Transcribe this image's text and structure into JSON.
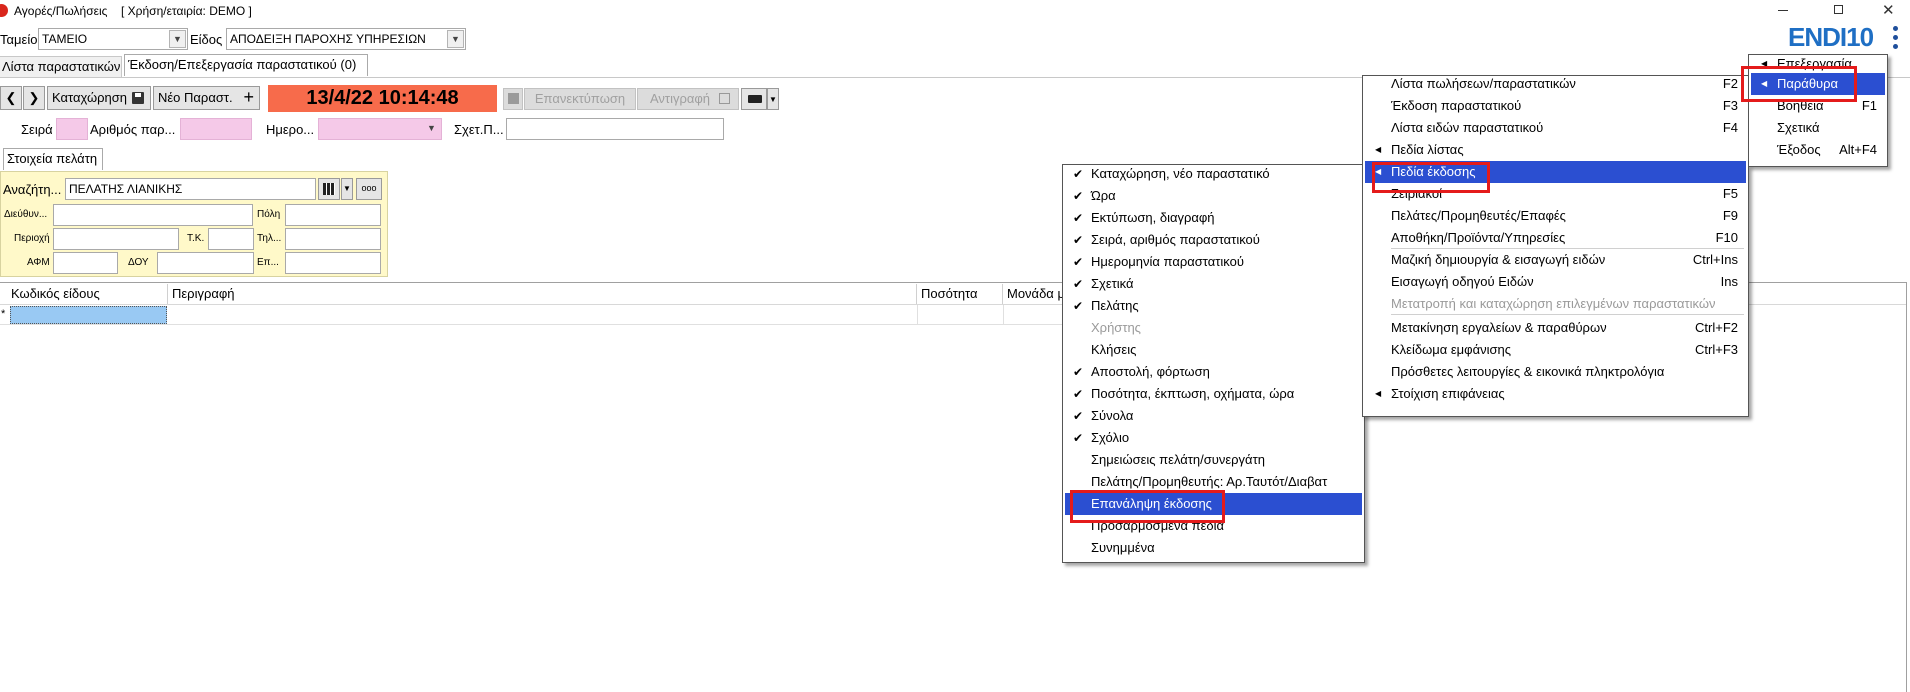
{
  "window": {
    "title": "Αγορές/Πωλήσεις",
    "context": "[ Χρήση/εταιρία: DEMO ]",
    "brand": "ENDI10"
  },
  "filters": {
    "tameio_label": "Ταμείο",
    "tameio_value": "ΤΑΜΕΙΟ",
    "eidos_label": "Είδος",
    "eidos_value": "ΑΠΟΔΕΙΞΗ ΠΑΡΟΧΗΣ ΥΠΗΡΕΣΙΩΝ"
  },
  "tabs": [
    {
      "label": "Λίστα παραστατικών"
    },
    {
      "label": "Έκδοση/Επεξεργασία παραστατικού (0)"
    }
  ],
  "toolbar": {
    "save_label": "Καταχώρηση",
    "new_label": "Νέο Παραστ.",
    "datetime": "13/4/22 10:14:48",
    "reprint_label": "Επανεκτύπωση",
    "copy_label": "Αντιγραφή"
  },
  "fields": {
    "series_label": "Σειρά",
    "number_label": "Αριθμός παρ...",
    "date_label": "Ημερο...",
    "related_label": "Σχετ.Π..."
  },
  "customer": {
    "tab_label": "Στοιχεία πελάτη",
    "search_label": "Αναζήτη...",
    "search_value": "ΠΕΛΑΤΗΣ ΛΙΑΝΙΚΗΣ",
    "address_label": "Διεύθυν...",
    "city_label": "Πόλη",
    "area_label": "Περιοχή",
    "zip_label": "Τ.Κ.",
    "phone_label": "Τηλ...",
    "afm_label": "ΑΦΜ",
    "doy_label": "ΔΟΥ",
    "job_label": "Επ..."
  },
  "grid": {
    "columns": [
      "Κωδικός είδους",
      "Περιγραφή",
      "Ποσότητα",
      "Μονάδα μ"
    ],
    "new_row_marker": "*"
  },
  "top_menu": {
    "items": [
      {
        "label": "Επεξεργασία",
        "shortcut": ""
      },
      {
        "label": "Παράθυρα",
        "shortcut": ""
      },
      {
        "label": "Βοήθεια",
        "shortcut": "F1"
      },
      {
        "label": "Σχετικά",
        "shortcut": ""
      },
      {
        "label": "Έξοδος",
        "shortcut": "Alt+F4"
      }
    ]
  },
  "windows_menu": {
    "items": [
      {
        "label": "Λίστα πωλήσεων/παραστατικών",
        "shortcut": "F2"
      },
      {
        "label": "Έκδοση παραστατικού",
        "shortcut": "F3"
      },
      {
        "label": "Λίστα ειδών παραστατικού",
        "shortcut": "F4"
      },
      {
        "label": "Πεδία λίστας",
        "shortcut": ""
      },
      {
        "label": "Πεδία έκδοσης",
        "shortcut": ""
      },
      {
        "label": "Σειριακοί",
        "shortcut": "F5"
      },
      {
        "label": "Πελάτες/Προμηθευτές/Επαφές",
        "shortcut": "F9"
      },
      {
        "label": "Αποθήκη/Προϊόντα/Υπηρεσίες",
        "shortcut": "F10"
      },
      {
        "label": "Μαζική δημιουργία & εισαγωγή ειδών",
        "shortcut": "Ctrl+Ins"
      },
      {
        "label": "Εισαγωγή οδηγού Ειδών",
        "shortcut": "Ins"
      },
      {
        "label": "Μετατροπή και καταχώρηση επιλεγμένων παραστατικών",
        "shortcut": ""
      },
      {
        "label": "Μετακίνηση εργαλείων & παραθύρων",
        "shortcut": "Ctrl+F2"
      },
      {
        "label": "Κλείδωμα εμφάνισης",
        "shortcut": "Ctrl+F3"
      },
      {
        "label": "Πρόσθετες λειτουργίες & εικονικά πληκτρολόγια",
        "shortcut": ""
      },
      {
        "label": "Στοίχιση επιφάνειας",
        "shortcut": ""
      }
    ]
  },
  "fields_menu": {
    "items": [
      {
        "label": "Καταχώρηση, νέο παραστατικό",
        "checked": true
      },
      {
        "label": "Ώρα",
        "checked": true
      },
      {
        "label": "Εκτύπωση, διαγραφή",
        "checked": true
      },
      {
        "label": "Σειρά, αριθμός παραστατικού",
        "checked": true
      },
      {
        "label": "Ημερομηνία παραστατικού",
        "checked": true
      },
      {
        "label": "Σχετικά",
        "checked": true
      },
      {
        "label": "Πελάτης",
        "checked": true
      },
      {
        "label": "Χρήστης",
        "checked": false
      },
      {
        "label": "Κλήσεις",
        "checked": false
      },
      {
        "label": "Αποστολή, φόρτωση",
        "checked": true
      },
      {
        "label": "Ποσότητα, έκπτωση, οχήματα, ώρα",
        "checked": true
      },
      {
        "label": "Σύνολα",
        "checked": true
      },
      {
        "label": "Σχόλιο",
        "checked": true
      },
      {
        "label": "Σημειώσεις πελάτη/συνεργάτη",
        "checked": false
      },
      {
        "label": "Πελάτης/Προμηθευτής: Αρ.Ταυτότ/Διαβατ",
        "checked": false
      },
      {
        "label": "Επανάληψη έκδοσης",
        "checked": false
      },
      {
        "label": "Προσαρμοσμένα πεδία",
        "checked": false
      },
      {
        "label": "Συνημμένα",
        "checked": false
      }
    ]
  },
  "colors": {
    "highlight": "#2b4fd1",
    "datetime_bg": "#f76b4b",
    "annotation": "#e41b1b",
    "customer_panel": "#fff9c9",
    "pink_field": "#f5c9e8"
  }
}
